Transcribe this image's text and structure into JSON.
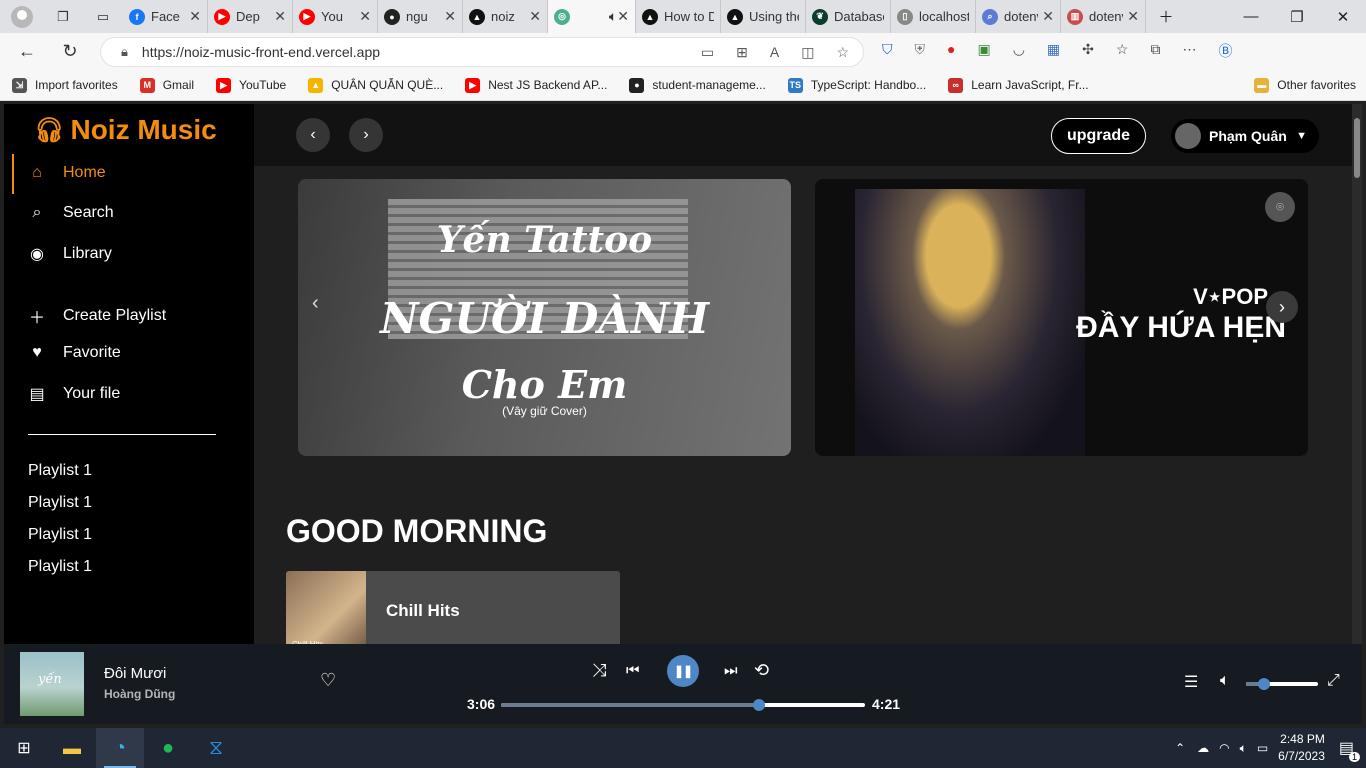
{
  "browser": {
    "tabs": [
      {
        "title": "Face",
        "fav_color": "#1877f2",
        "fav_glyph": "f"
      },
      {
        "title": "Dep",
        "fav_color": "#ff0000",
        "fav_glyph": "▶"
      },
      {
        "title": "You",
        "fav_color": "#ff0000",
        "fav_glyph": "▶"
      },
      {
        "title": "ngu",
        "fav_color": "#222222",
        "fav_glyph": "●"
      },
      {
        "title": "noiz",
        "fav_color": "#111111",
        "fav_glyph": "▲"
      },
      {
        "title": "",
        "fav_color": "#4caf92",
        "fav_glyph": "◎"
      },
      {
        "title": "How to D",
        "fav_color": "#111111",
        "fav_glyph": "▲"
      },
      {
        "title": "Using the",
        "fav_color": "#111111",
        "fav_glyph": "▲"
      },
      {
        "title": "Database",
        "fav_color": "#0b3d2e",
        "fav_glyph": "❦"
      },
      {
        "title": "localhost",
        "fav_color": "#888888",
        "fav_glyph": "▯"
      },
      {
        "title": "dotenv n",
        "fav_color": "#5b7bd5",
        "fav_glyph": "⌕"
      },
      {
        "title": "dotenv -",
        "fav_color": "#c94f4f",
        "fav_glyph": "▥"
      }
    ],
    "url": "https://noiz-music-front-end.vercel.app",
    "favorites": [
      {
        "label": "Import favorites",
        "color": "#555555",
        "glyph": "⇲"
      },
      {
        "label": "Gmail",
        "color": "#d93025",
        "glyph": "M"
      },
      {
        "label": "YouTube",
        "color": "#ff0000",
        "glyph": "▶"
      },
      {
        "label": "QUÂN QUẪN QUÈ...",
        "color": "#f4b400",
        "glyph": "▲"
      },
      {
        "label": "Nest JS Backend AP...",
        "color": "#ff0000",
        "glyph": "▶"
      },
      {
        "label": "student-manageme...",
        "color": "#222222",
        "glyph": "●"
      },
      {
        "label": "TypeScript: Handbo...",
        "color": "#3178c6",
        "glyph": "TS"
      },
      {
        "label": "Learn JavaScript, Fr...",
        "color": "#c4302b",
        "glyph": "∞"
      }
    ],
    "other_favorites": "Other favorites"
  },
  "app": {
    "brand": "Noiz Music",
    "nav": [
      {
        "label": "Home",
        "icon": "home-icon",
        "glyph": "⌂"
      },
      {
        "label": "Search",
        "icon": "search-icon",
        "glyph": "⌕"
      },
      {
        "label": "Library",
        "icon": "library-icon",
        "glyph": "◉"
      },
      {
        "label": "Create Playlist",
        "icon": "plus-square-icon",
        "glyph": "＋"
      },
      {
        "label": "Favorite",
        "icon": "heart-icon",
        "glyph": "♥"
      },
      {
        "label": "Your file",
        "icon": "file-icon",
        "glyph": "▤"
      }
    ],
    "playlists": [
      "Playlist 1",
      "Playlist 1",
      "Playlist 1",
      "Playlist 1"
    ],
    "upgrade": "upgrade",
    "user_name": "Phạm Quân",
    "banners": [
      {
        "line1": "Yến Tattoo",
        "line2": "NGƯỜI DÀNH",
        "line3": "Cho Em",
        "line4": "(Vây giữ Cover)"
      },
      {
        "line1": "V⋆POP",
        "line2": "ĐẦY HỨA HẸN"
      }
    ],
    "section_title": "GOOD MORNING",
    "card_title": "Chill Hits",
    "card_image_text": "Chill Hits"
  },
  "player": {
    "cover_text": "yến",
    "song": "Đôi Mươi",
    "artist": "Hoàng Dũng",
    "current": "3:06",
    "total": "4:21",
    "progress": 0.71,
    "volume": 0.25
  },
  "taskbar": {
    "time": "2:48 PM",
    "date": "6/7/2023",
    "notif_count": "1",
    "accent": "#7ab8f0"
  }
}
